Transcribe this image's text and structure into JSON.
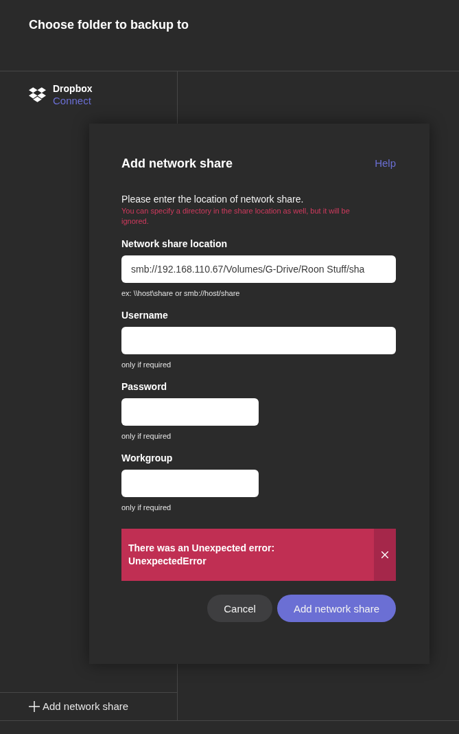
{
  "header": {
    "title": "Choose folder to backup to"
  },
  "sidebar": {
    "items": [
      {
        "name": "Dropbox",
        "action": "Connect"
      }
    ],
    "footer_button": {
      "label": "Add network share"
    }
  },
  "dialog": {
    "title": "Add network share",
    "help_link": "Help",
    "instruction": "Please enter the location of network share.",
    "note": "You can specify a directory in the share location as well, but it will be ignored.",
    "fields": [
      {
        "label": "Network share location",
        "kind": "wide",
        "value": "smb://192.168.110.67/Volumes/G-Drive/Roon Stuff/sha",
        "hint": "ex: \\\\host\\share or smb://host/share"
      },
      {
        "label": "Username",
        "kind": "wide",
        "hint": "only if required"
      },
      {
        "label": "Password",
        "kind": "narrow",
        "hint": "only if required"
      },
      {
        "label": "Workgroup",
        "kind": "narrow",
        "hint": "only if required"
      }
    ],
    "error": {
      "message": "There was an Unexpected error:",
      "detail": "UnexpectedError"
    },
    "buttons": [
      {
        "label": "Cancel",
        "kind": "secondary"
      },
      {
        "label": "Add network share",
        "kind": "primary"
      }
    ]
  }
}
